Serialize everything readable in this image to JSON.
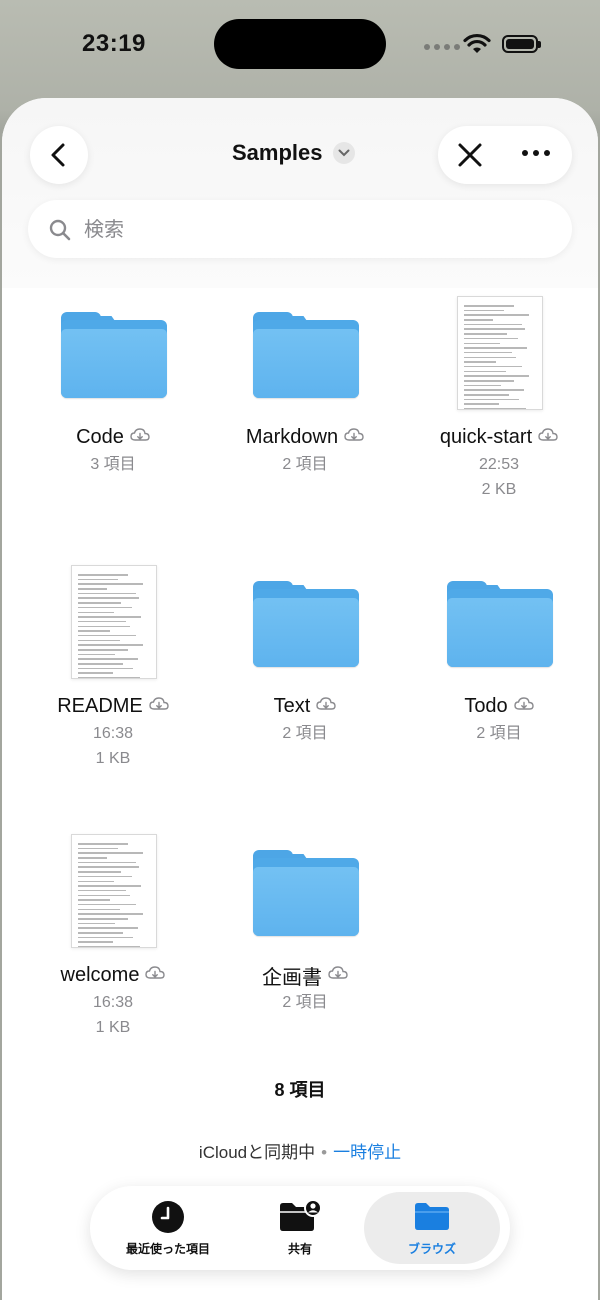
{
  "status_bar": {
    "time": "23:19"
  },
  "nav": {
    "title": "Samples"
  },
  "search": {
    "placeholder": "検索"
  },
  "items": [
    {
      "name": "Code",
      "kind": "folder",
      "meta": "3 項目",
      "meta2": ""
    },
    {
      "name": "Markdown",
      "kind": "folder",
      "meta": "2 項目",
      "meta2": ""
    },
    {
      "name": "quick-start",
      "kind": "document",
      "meta": "22:53",
      "meta2": "2 KB"
    },
    {
      "name": "README",
      "kind": "document",
      "meta": "16:38",
      "meta2": "1 KB"
    },
    {
      "name": "Text",
      "kind": "folder",
      "meta": "2 項目",
      "meta2": ""
    },
    {
      "name": "Todo",
      "kind": "folder",
      "meta": "2 項目",
      "meta2": ""
    },
    {
      "name": "welcome",
      "kind": "document",
      "meta": "16:38",
      "meta2": "1 KB"
    },
    {
      "name": "企画書",
      "kind": "folder",
      "meta": "2 項目",
      "meta2": ""
    }
  ],
  "footer": {
    "count": "8 項目",
    "sync_text": "iCloudと同期中",
    "pause_label": "一時停止"
  },
  "tabbar": {
    "recents_label": "最近使った項目",
    "shared_label": "共有",
    "browse_label": "ブラウズ",
    "accent": "#1a7fe0"
  },
  "colors": {
    "folder": "#5eb3ee",
    "accent": "#1a7fe0"
  }
}
